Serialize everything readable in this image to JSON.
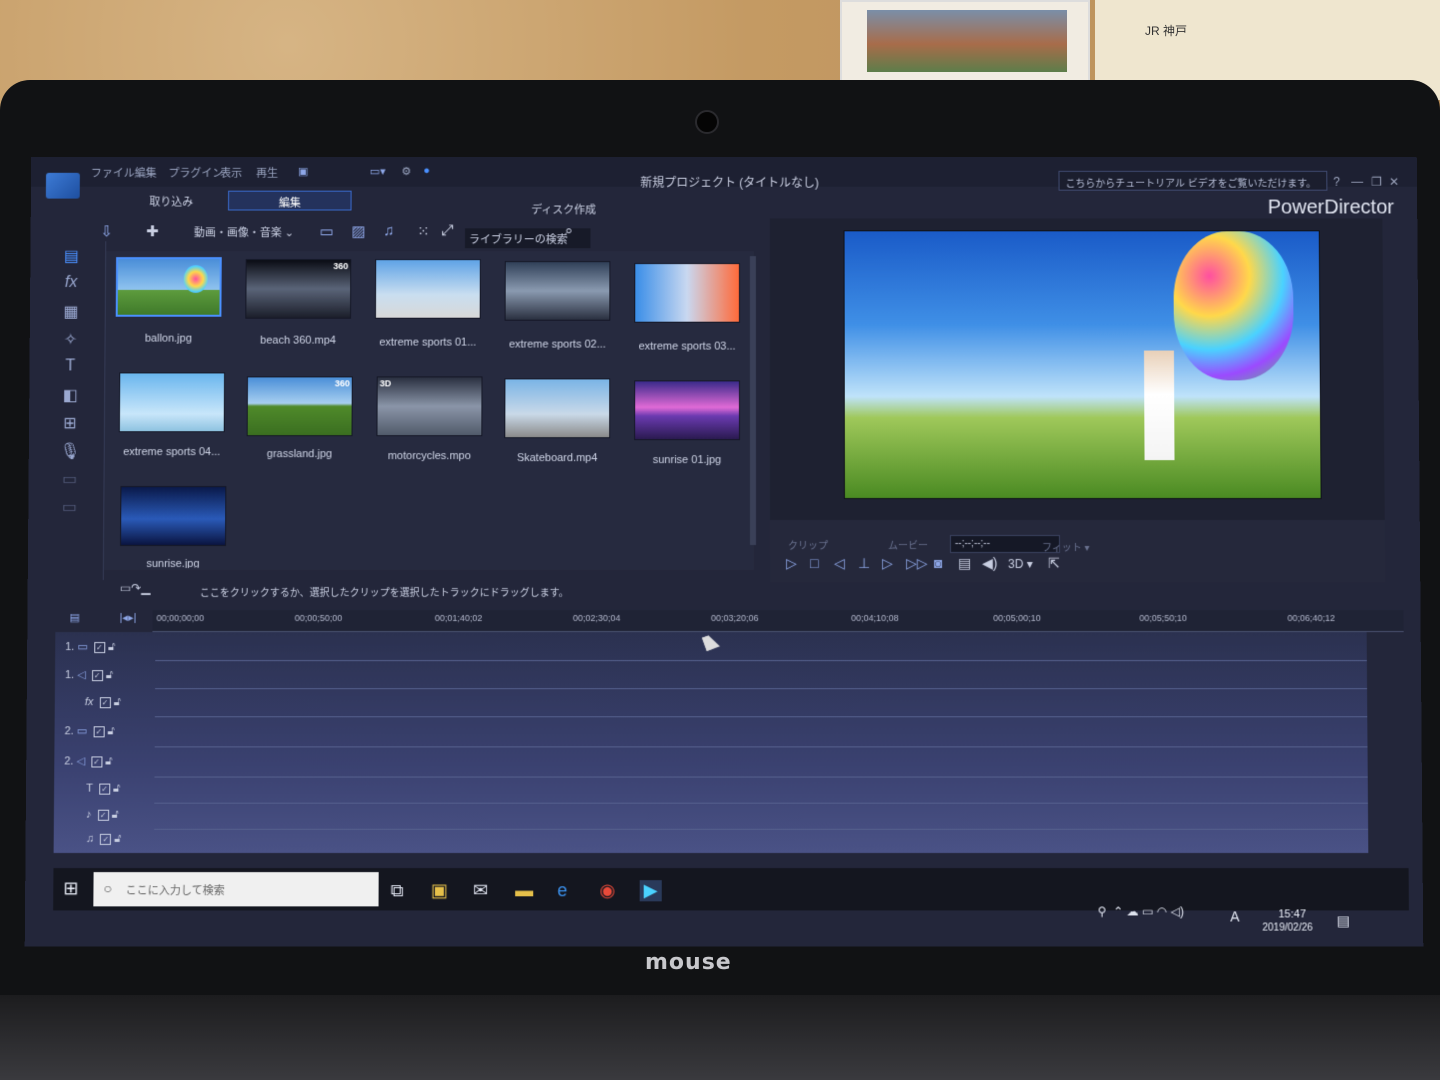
{
  "window": {
    "title": "新規プロジェクト (タイトルなし)",
    "brand": "PowerDirector",
    "tutorial": "こちらからチュートリアル ビデオをご覧いただけます。"
  },
  "menu": [
    "ファイル",
    "編集",
    "プラグイン",
    "表示",
    "再生"
  ],
  "tabs": {
    "import": "取り込み",
    "edit": "編集",
    "disc": "ディスク作成"
  },
  "library": {
    "filter": "動画・画像・音楽",
    "search_placeholder": "ライブラリーの検索",
    "items": [
      {
        "name": "ballon.jpg",
        "badge": ""
      },
      {
        "name": "beach 360.mp4",
        "badge": "360"
      },
      {
        "name": "extreme sports 01...",
        "badge": ""
      },
      {
        "name": "extreme sports 02...",
        "badge": ""
      },
      {
        "name": "extreme sports 03...",
        "badge": ""
      },
      {
        "name": "extreme sports 04...",
        "badge": ""
      },
      {
        "name": "grassland.jpg",
        "badge": "360"
      },
      {
        "name": "motorcycles.mpo",
        "badge": "3D"
      },
      {
        "name": "Skateboard.mp4",
        "badge": ""
      },
      {
        "name": "sunrise 01.jpg",
        "badge": ""
      },
      {
        "name": "sunrise.jpg",
        "badge": ""
      }
    ]
  },
  "preview": {
    "clip_tab": "クリップ",
    "movie_tab": "ムービー",
    "timecode": "--;--;--;--",
    "fit": "フィット",
    "mode_3d": "3D"
  },
  "timeline": {
    "hint": "ここをクリックするか、選択したクリップを選択したトラックにドラッグします。",
    "ticks": [
      "00;00;00;00",
      "00;00;50;00",
      "00;01;40;02",
      "00;02;30;04",
      "00;03;20;06",
      "00;04;10;08",
      "00;05;00;10",
      "00;05;50;10",
      "00;06;40;12"
    ],
    "tracks": [
      "1.",
      "1.",
      "fx",
      "2.",
      "2.",
      "T",
      "",
      ""
    ]
  },
  "taskbar": {
    "search_placeholder": "ここに入力して検索",
    "time": "15:47",
    "date": "2019/02/26",
    "ime": "A"
  },
  "laptop": {
    "brand": "mouse"
  },
  "background": {
    "map_label": "JR 神戸"
  }
}
